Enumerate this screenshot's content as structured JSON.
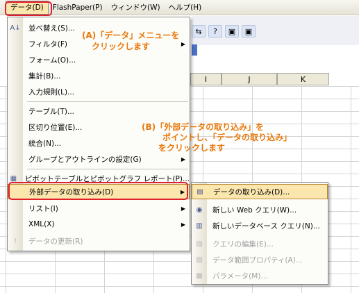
{
  "menubar": {
    "items": [
      {
        "label": "データ(D)",
        "active": true
      },
      {
        "label": "FlashPaper(P)"
      },
      {
        "label": "ウィンドウ(W)"
      },
      {
        "label": "ヘルプ(H)"
      }
    ]
  },
  "columns": [
    "I",
    "J",
    "K"
  ],
  "menu": {
    "items": [
      {
        "label": "並べ替え(S)...",
        "icon": "sort-az-icon"
      },
      {
        "label": "フィルタ(F)",
        "submenu": true
      },
      {
        "label": "フォーム(O)..."
      },
      {
        "label": "集計(B)..."
      },
      {
        "label": "入力規則(L)..."
      },
      {
        "label": "テーブル(T)..."
      },
      {
        "label": "区切り位置(E)..."
      },
      {
        "label": "統合(N)..."
      },
      {
        "label": "グループとアウトラインの設定(G)",
        "submenu": true
      },
      {
        "label": "ピボットテーブルとピボットグラフ レポート(P)...",
        "icon": "pivot-table-icon"
      },
      {
        "label": "外部データの取り込み(D)",
        "submenu": true,
        "highlighted": true
      },
      {
        "label": "リスト(I)",
        "submenu": true
      },
      {
        "label": "XML(X)",
        "submenu": true
      },
      {
        "label": "データの更新(R)",
        "icon": "refresh-icon",
        "disabled": true
      }
    ]
  },
  "submenu": {
    "items": [
      {
        "label": "データの取り込み(D)...",
        "icon": "import-data-icon",
        "highlighted": true
      },
      {
        "label": "新しい Web クエリ(W)...",
        "icon": "web-query-icon"
      },
      {
        "label": "新しいデータベース クエリ(N)...",
        "icon": "database-query-icon"
      },
      {
        "label": "クエリの編集(E)...",
        "icon": "edit-query-icon",
        "disabled": true
      },
      {
        "label": "データ範囲プロパティ(A)...",
        "icon": "range-properties-icon",
        "disabled": true
      },
      {
        "label": "パラメータ(M)...",
        "icon": "parameters-icon",
        "disabled": true
      }
    ]
  },
  "annotations": {
    "a_line1": "(A)「データ」メニューを",
    "a_line2": "クリックします",
    "b_line1": "(B)「外部データの取り込み」を",
    "b_line2": "ポイントし、「データの取り込み」",
    "b_line3": "をクリックします"
  },
  "colors": {
    "annotation": "#e8780a",
    "highlight_box": "#e0202a",
    "menu_hover": "#fbe6ae"
  }
}
